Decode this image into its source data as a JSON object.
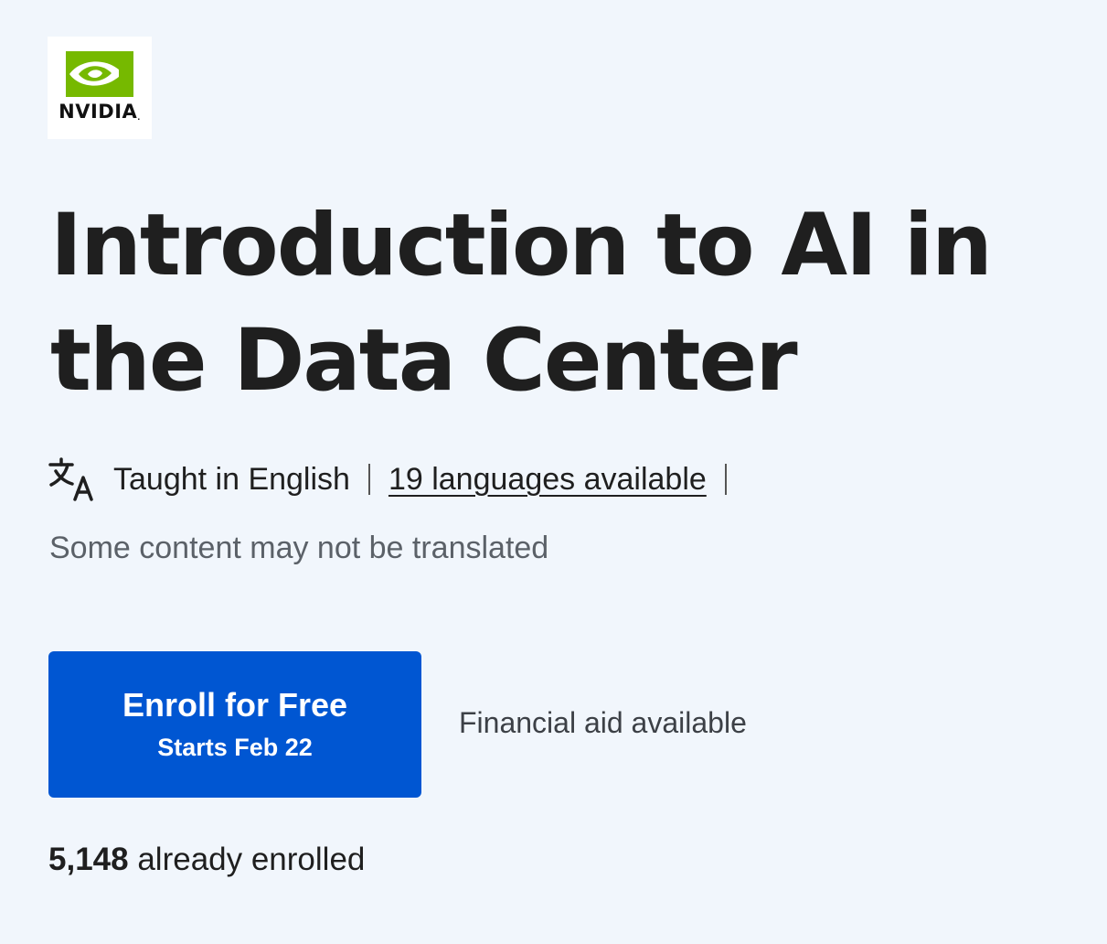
{
  "brand": {
    "logo_text": "NVIDIA",
    "logo_green": "#76b900",
    "logo_icon": "nvidia-eye-icon"
  },
  "course": {
    "title": "Introduction to AI in the Data Center"
  },
  "language": {
    "icon": "translate-icon",
    "taught": "Taught in English",
    "available_link": "19 languages available",
    "note": "Some content may not be translated"
  },
  "enroll": {
    "button_label": "Enroll for Free",
    "start_text": "Starts Feb 22",
    "button_color": "#0056d2",
    "financial_aid": "Financial aid available"
  },
  "enrollment": {
    "count": "5,148",
    "suffix": "already enrolled"
  },
  "colors": {
    "background": "#f1f6fc",
    "text": "#1f1f1f"
  }
}
